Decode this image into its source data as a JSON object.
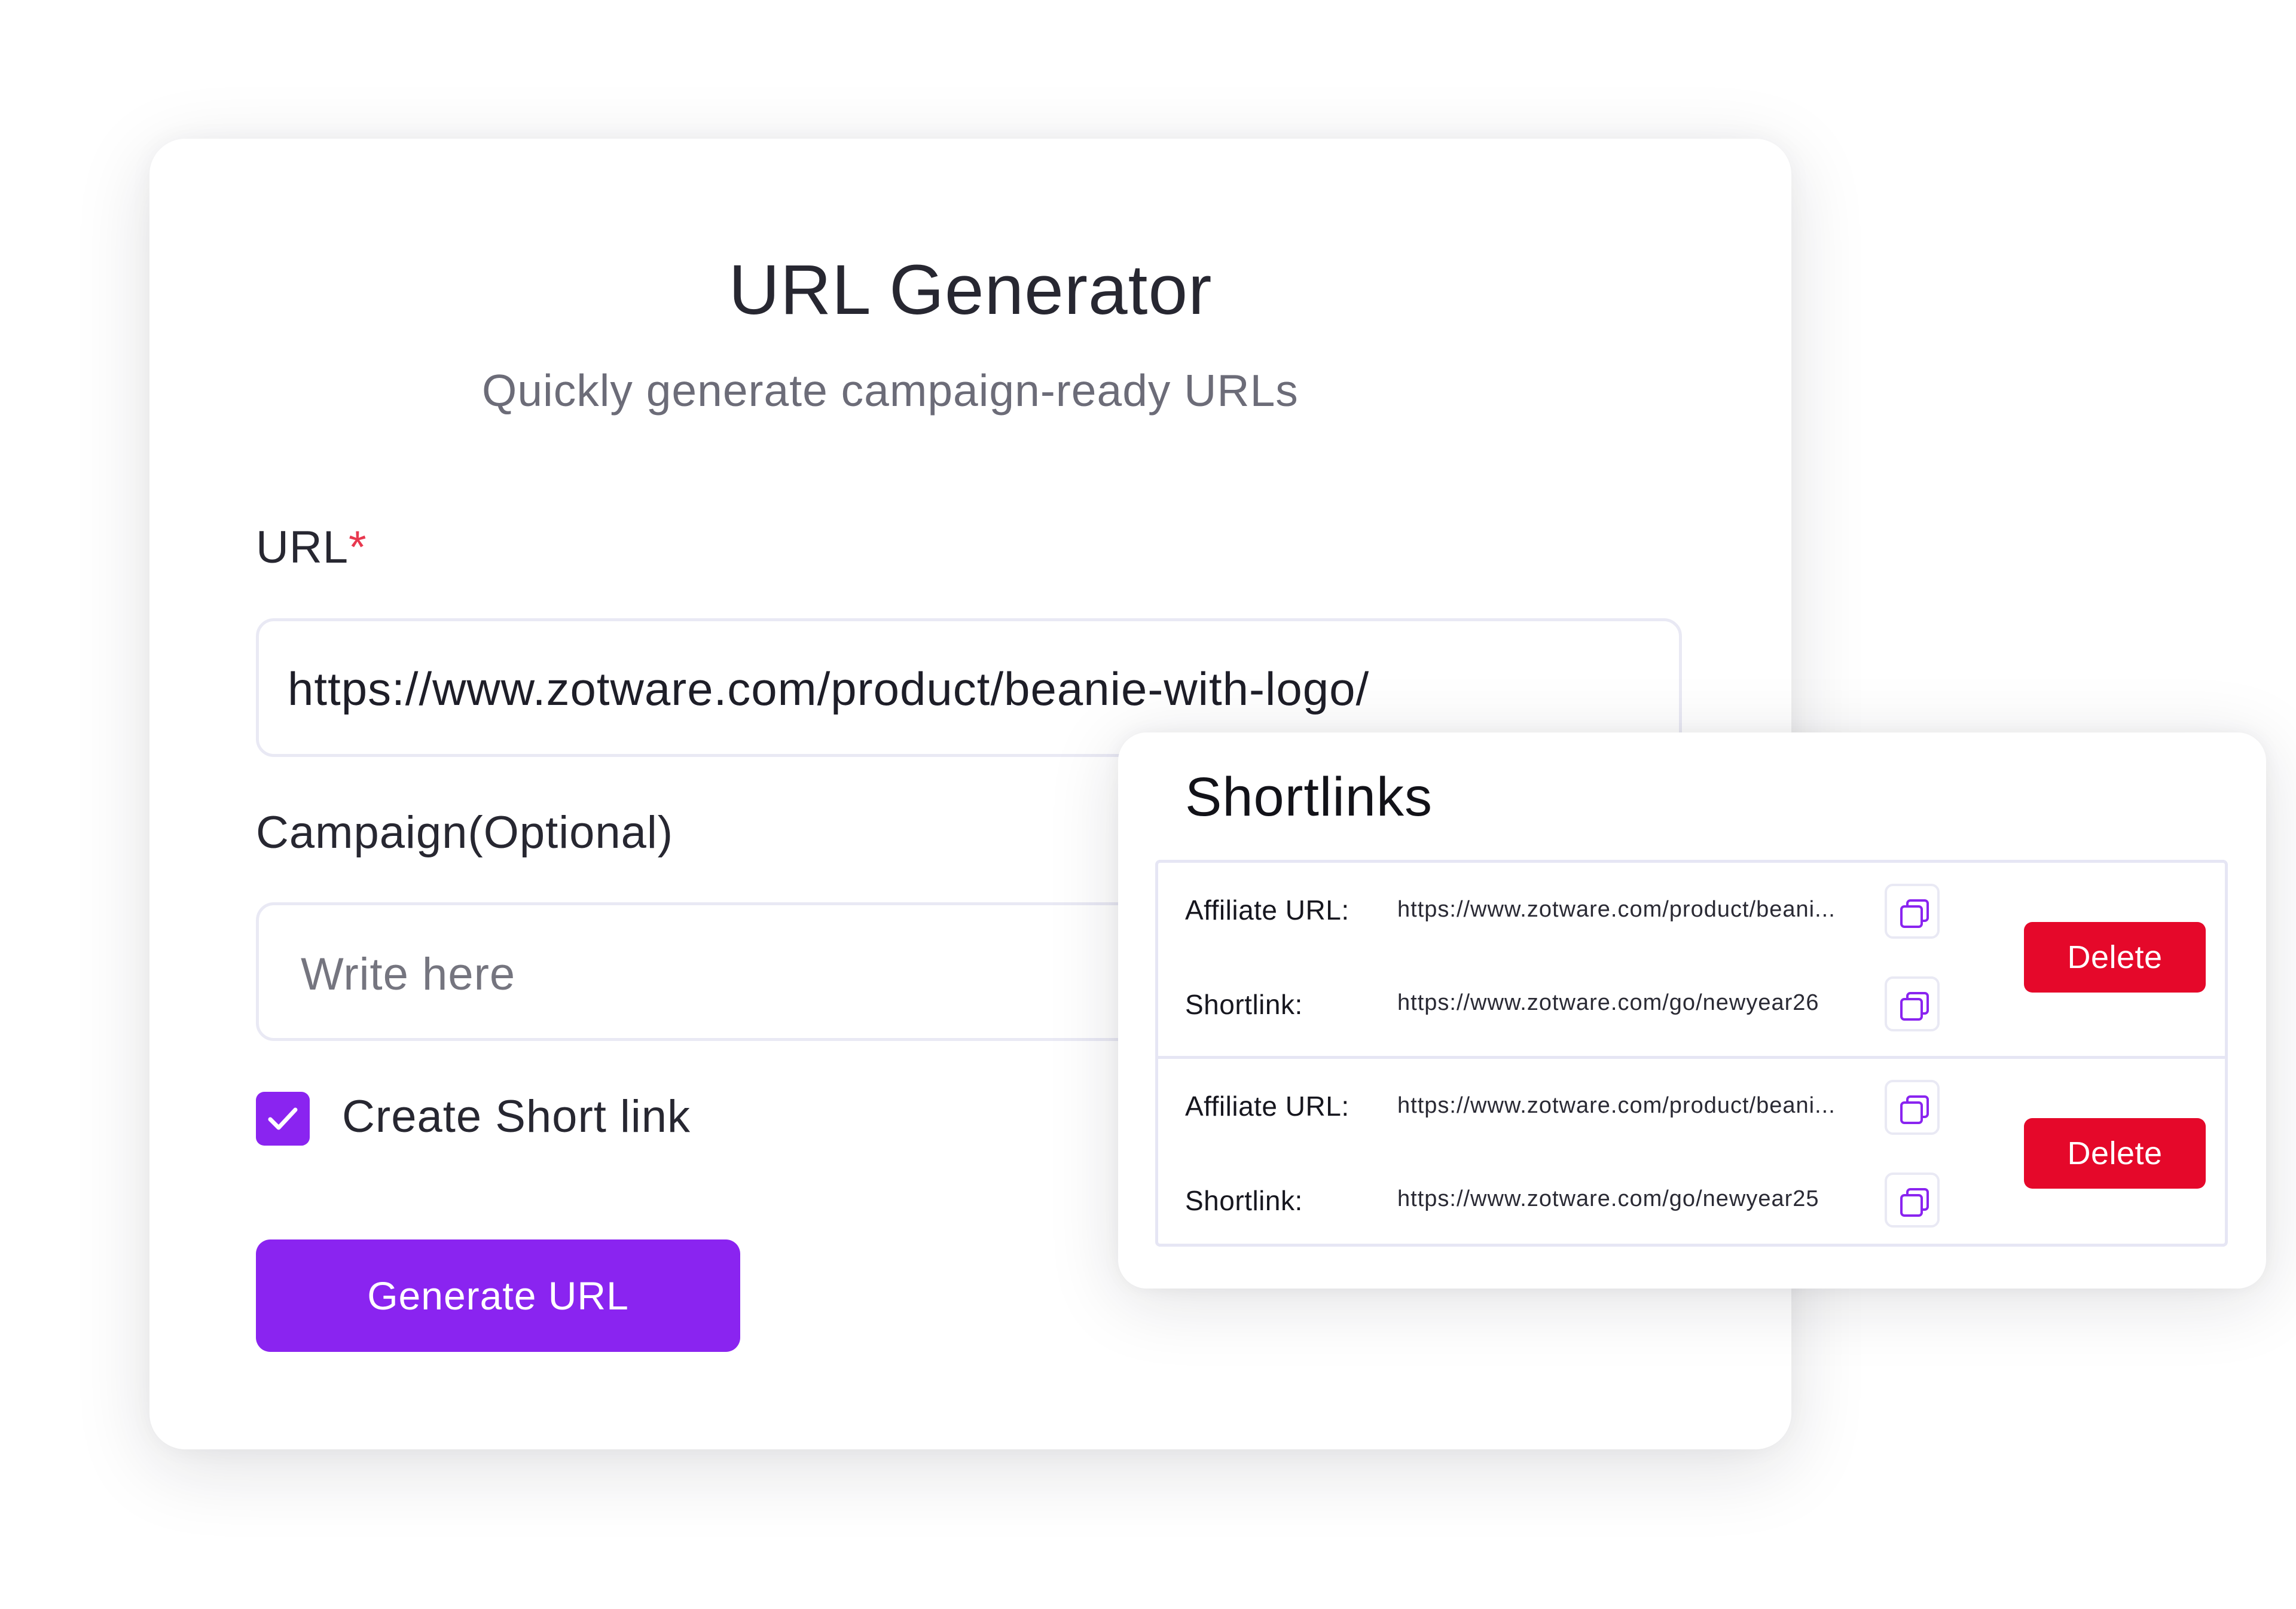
{
  "generator": {
    "title": "URL Generator",
    "subtitle": "Quickly generate campaign-ready URLs",
    "url_label": "URL",
    "required_marker": "*",
    "url_value": "https://www.zotware.com/product/beanie-with-logo/",
    "campaign_label": "Campaign(Optional)",
    "campaign_placeholder": "Write here",
    "short_link_label": "Create Short link",
    "short_link_checked": true,
    "generate_label": "Generate URL"
  },
  "shortlinks": {
    "title": "Shortlinks",
    "rows": [
      {
        "affiliate_label": "Affiliate URL:",
        "affiliate_url": "https://www.zotware.com/product/beani...",
        "shortlink_label": "Shortlink:",
        "shortlink_url": "https://www.zotware.com/go/newyear26",
        "delete_label": "Delete"
      },
      {
        "affiliate_label": "Affiliate URL:",
        "affiliate_url": "https://www.zotware.com/product/beani...",
        "shortlink_label": "Shortlink:",
        "shortlink_url": "https://www.zotware.com/go/newyear25",
        "delete_label": "Delete"
      }
    ]
  },
  "colors": {
    "accent": "#8a24f0",
    "danger": "#e5082a",
    "required": "#e8384f"
  },
  "icons": {
    "copy": "copy-icon",
    "check": "check-icon"
  }
}
